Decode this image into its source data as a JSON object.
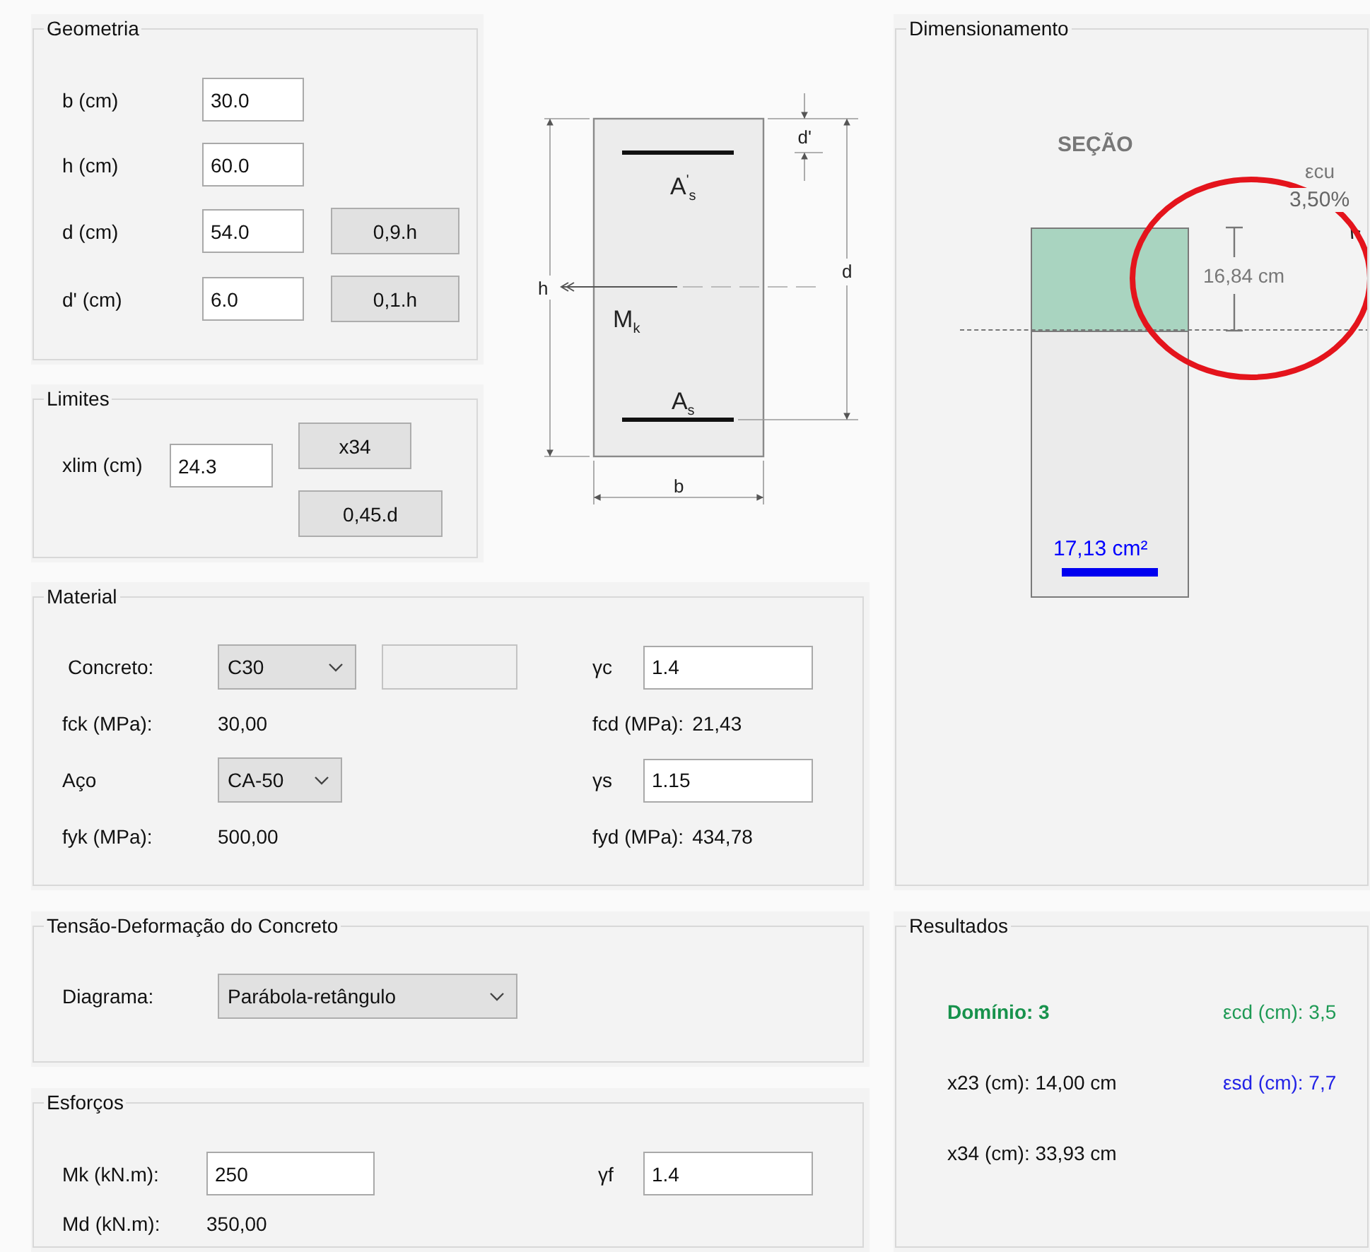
{
  "geometria": {
    "title": "Geometria",
    "fields": [
      {
        "label": "b (cm)",
        "value": "30.0"
      },
      {
        "label": "h (cm)",
        "value": "60.0"
      },
      {
        "label": "d (cm)",
        "value": "54.0",
        "button": "0,9.h"
      },
      {
        "label": "d' (cm)",
        "value": "6.0",
        "button": "0,1.h"
      }
    ]
  },
  "limites": {
    "title": "Limites",
    "label": "xlim (cm)",
    "value": "24.3",
    "buttons": [
      "x34",
      "0,45.d"
    ]
  },
  "section_diagram": {
    "h": "h",
    "d": "d",
    "d_prime": "d'",
    "b": "b",
    "top_steel": "A$^{'}$$_{s}$",
    "bottom_steel": "A$_{s}$",
    "moment": "M$_{k}$"
  },
  "material": {
    "title": "Material",
    "concreto": {
      "label": "Concreto:",
      "value": "C30"
    },
    "gamma_c": {
      "label": "γc",
      "value": "1.4"
    },
    "fck": {
      "label": "fck (MPa):",
      "value": "30,00"
    },
    "fcd": {
      "label": "fcd (MPa):",
      "value": "21,43"
    },
    "aco": {
      "label": "Aço",
      "value": "CA-50"
    },
    "gamma_s": {
      "label": "γs",
      "value": "1.15"
    },
    "fyk": {
      "label": "fyk (MPa):",
      "value": "500,00"
    },
    "fyd": {
      "label": "fyd (MPa):",
      "value": "434,78"
    }
  },
  "tensao": {
    "title": "Tensão-Deformação do Concreto",
    "label": "Diagrama:",
    "value": "Parábola-retângulo"
  },
  "esforcos": {
    "title": "Esforços",
    "mk": {
      "label": "Mk (kN.m):",
      "value": "250"
    },
    "gamma_f": {
      "label": "γf",
      "value": "1.4"
    },
    "md": {
      "label": "Md (kN.m):",
      "value": "350,00"
    }
  },
  "dimensionamento": {
    "title": "Dimensionamento",
    "section_title": "SEÇÃO",
    "compression_depth": "16,84 cm",
    "steel_area": "17,13 cm²",
    "strain_label": "εcu",
    "strain_value": "3,50%"
  },
  "resultados": {
    "title": "Resultados",
    "dominio": "Domínio: 3",
    "ecd": "εcd (cm): 3,5",
    "x23": "x23 (cm): 14,00 cm",
    "esd": "εsd (cm): 7,7",
    "x34": "x34 (cm): 33,93 cm"
  }
}
